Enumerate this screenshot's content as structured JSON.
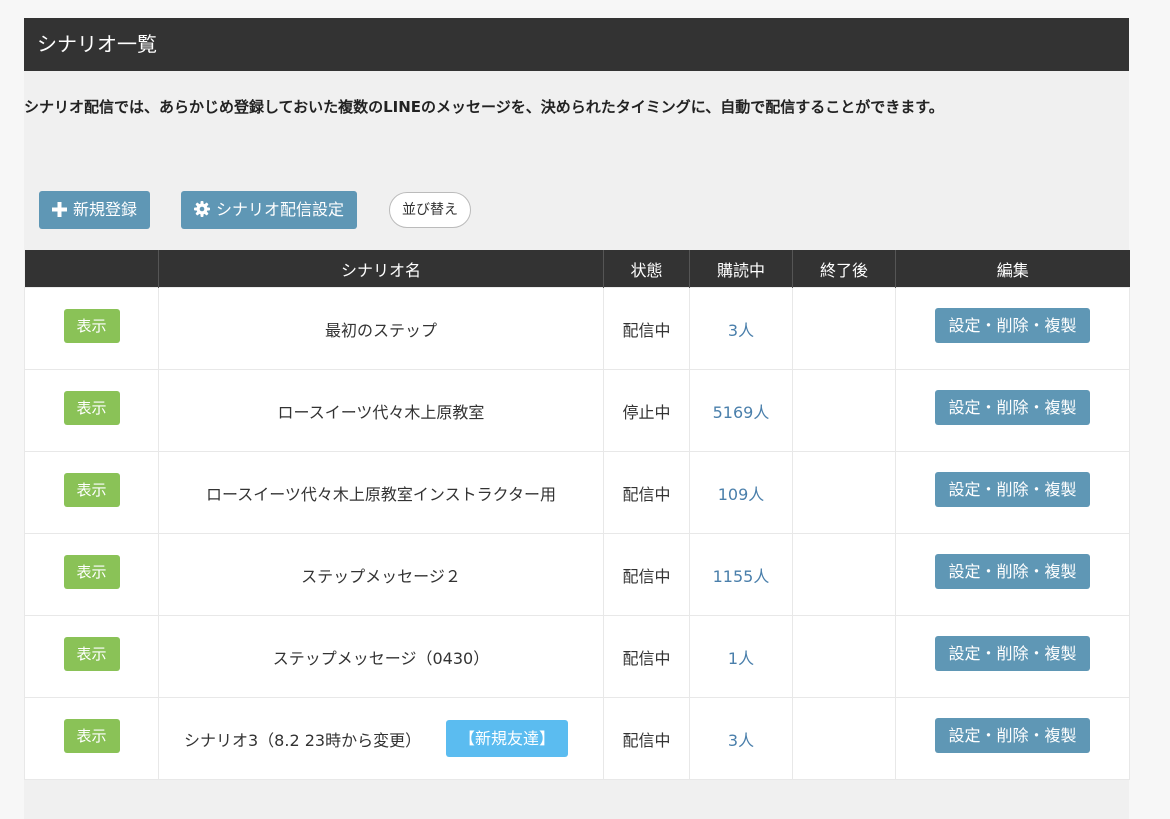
{
  "header": {
    "title": "シナリオ一覧"
  },
  "description": "シナリオ配信では、あらかじめ登録しておいた複数のLINEのメッセージを、決められたタイミングに、自動で配信することができます。",
  "toolbar": {
    "new_label": "新規登録",
    "settings_label": "シナリオ配信設定",
    "sort_label": "並び替え"
  },
  "table": {
    "columns": [
      "",
      "シナリオ名",
      "状態",
      "購読中",
      "終了後",
      "編集"
    ],
    "rows": [
      {
        "show": "表示",
        "name": "最初のステップ",
        "badge": "",
        "status": "配信中",
        "subscribers": "3人",
        "after_end": "",
        "edit": "設定・削除・複製"
      },
      {
        "show": "表示",
        "name": "ロースイーツ代々木上原教室",
        "badge": "",
        "status": "停止中",
        "subscribers": "5169人",
        "after_end": "",
        "edit": "設定・削除・複製"
      },
      {
        "show": "表示",
        "name": "ロースイーツ代々木上原教室インストラクター用",
        "badge": "",
        "status": "配信中",
        "subscribers": "109人",
        "after_end": "",
        "edit": "設定・削除・複製"
      },
      {
        "show": "表示",
        "name": "ステップメッセージ２",
        "badge": "",
        "status": "配信中",
        "subscribers": "1155人",
        "after_end": "",
        "edit": "設定・削除・複製"
      },
      {
        "show": "表示",
        "name": "ステップメッセージ（0430）",
        "badge": "",
        "status": "配信中",
        "subscribers": "1人",
        "after_end": "",
        "edit": "設定・削除・複製"
      },
      {
        "show": "表示",
        "name": "シナリオ3（8.2 23時から変更）",
        "badge": "【新規友達】",
        "status": "配信中",
        "subscribers": "3人",
        "after_end": "",
        "edit": "設定・削除・複製"
      }
    ]
  },
  "colors": {
    "header_bg": "#333333",
    "primary_button": "#5f97b5",
    "show_button": "#8ac257",
    "badge": "#5bbcf0",
    "link": "#4a7fab"
  },
  "icons": {
    "new": "plus-icon",
    "settings": "gear-icon"
  }
}
